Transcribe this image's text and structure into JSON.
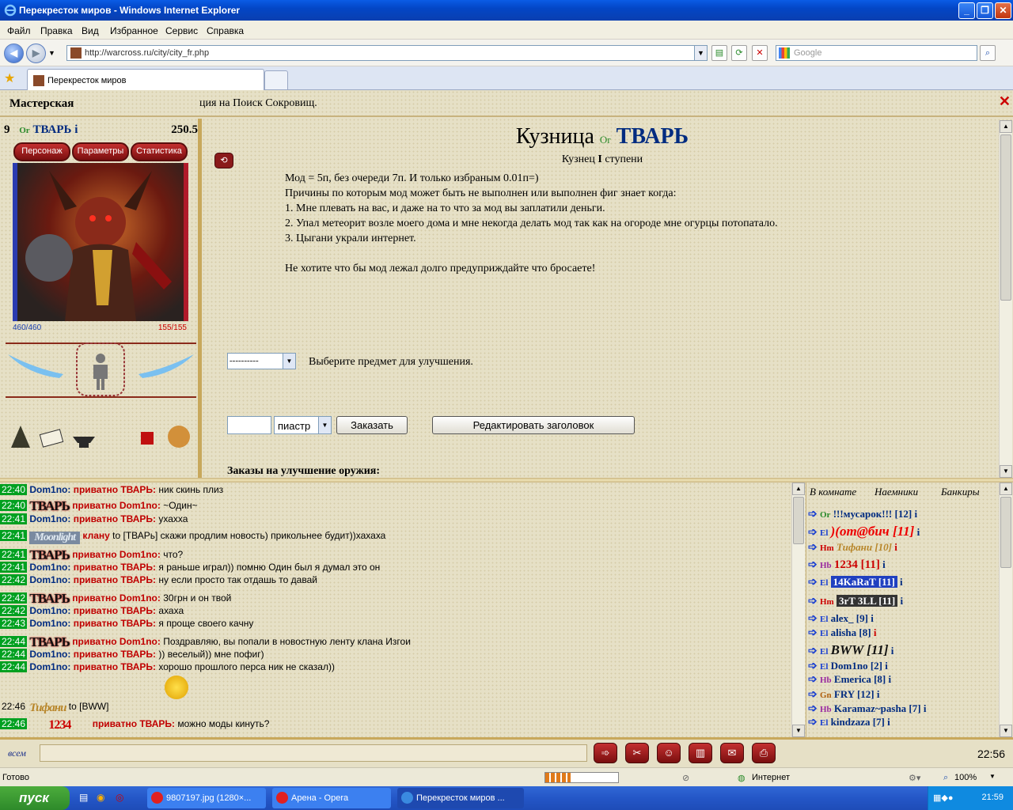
{
  "window": {
    "title": "Перекресток миров - Windows Internet Explorer"
  },
  "menu": [
    "Файл",
    "Правка",
    "Вид",
    "Избранное",
    "Сервис",
    "Справка"
  ],
  "address": {
    "url": "http://warcross.ru/city/city_fr.php"
  },
  "search": {
    "placeholder": "Google"
  },
  "tab": {
    "label": "Перекресток миров"
  },
  "top": {
    "location": "Мастерская",
    "ticker": "ция на Поиск Сокровищ."
  },
  "player": {
    "level": "9",
    "clan": "Or",
    "name": "ТВАРЬ",
    "info": "i",
    "exp": "250.5",
    "hp": "460/460",
    "mana": "155/155",
    "buttons": [
      "Персонаж",
      "Параметры",
      "Статистика"
    ]
  },
  "forge": {
    "title": "Кузница",
    "clan": "Or",
    "owner": "ТВАРЬ",
    "subtitle_pre": "Кузнец",
    "subtitle_level": "I",
    "subtitle_post": "ступени",
    "lines": [
      "Мод = 5п, без очереди 7п. И только избраным 0.01п=)",
      "Причины по которым мод может быть не выполнен или выполнен фиг знает когда:",
      "1. Мне плевать на вас, и даже на то что за мод вы заплатили деньги.",
      "2. Упал метеорит возле моего дома и мне некогда делать мод так как на огороде мне огурцы потопатало.",
      "3. Цыгани украли интернет.",
      "",
      "Не хотите что бы мод лежал долго предуприждайте что бросаете!"
    ],
    "select_value": "----------",
    "select_label": "Выберите предмет для улучшения.",
    "currency": "пиастр",
    "order_button": "Заказать",
    "edit_button": "Редактировать заголовок",
    "orders_title": "Заказы на улучшение оружия:"
  },
  "chat": [
    {
      "time": "22:40",
      "from": "Dom1no:",
      "priv": "приватно ТВАРЬ:",
      "text": "ник скинь плиз"
    },
    {
      "time": "22:40",
      "badge": "ТВАРЬ",
      "priv": "приватно Dom1no:",
      "text": "~Один~"
    },
    {
      "time": "22:41",
      "from": "Dom1no:",
      "priv": "приватно ТВАРЬ:",
      "text": "ухахха"
    },
    {
      "time": "22:41",
      "badge": "Moonlight",
      "priv": "клану",
      "text": "to [ТВАРь] скажи продлим новость) прикольнее будит))хахаха"
    },
    {
      "time": "22:41",
      "badge": "ТВАРЬ",
      "priv": "приватно Dom1no:",
      "text": "что?"
    },
    {
      "time": "22:41",
      "from": "Dom1no:",
      "priv": "приватно ТВАРЬ:",
      "text": "я раньше играл)) помню Один был я думал это он"
    },
    {
      "time": "22:42",
      "from": "Dom1no:",
      "priv": "приватно ТВАРЬ:",
      "text": "ну если просто так отдашь то давай"
    },
    {
      "time": "22:42",
      "badge": "ТВАРЬ",
      "priv": "приватно Dom1no:",
      "text": "30грн и он твой"
    },
    {
      "time": "22:42",
      "from": "Dom1no:",
      "priv": "приватно ТВАРЬ:",
      "text": "ахаха"
    },
    {
      "time": "22:43",
      "from": "Dom1no:",
      "priv": "приватно ТВАРЬ:",
      "text": "я проще своего качну"
    },
    {
      "time": "22:44",
      "badge": "ТВАРЬ",
      "priv": "приватно Dom1no:",
      "text": "Поздравляю, вы попали в новостную ленту клана Изгои"
    },
    {
      "time": "22:44",
      "from": "Dom1no:",
      "priv": "приватно ТВАРЬ:",
      "text": ")) веселый)) мне пофиг)"
    },
    {
      "time": "22:44",
      "from": "Dom1no:",
      "priv": "приватно ТВАРЬ:",
      "text": "хорошо прошлого перса ник не сказал))"
    },
    {
      "time": "22:46",
      "badge": "Тифани",
      "priv": "",
      "text": "to [BWW]"
    },
    {
      "time": "22:46",
      "badge": "1234",
      "priv": "приватно ТВАРЬ:",
      "text": "можно моды кинуть?"
    }
  ],
  "room": {
    "tabs": [
      "В комнате",
      "Наемники",
      "Банкиры"
    ],
    "users": [
      {
        "clan": "Or",
        "name": "!!!мусарок!!! [12]"
      },
      {
        "clan": "El",
        "name": ")(от@бич [11]"
      },
      {
        "clan": "Hm",
        "name": "Тифани [10]"
      },
      {
        "clan": "Hb",
        "name": "1234 [11]"
      },
      {
        "clan": "El",
        "name": "14KaRaT [11]"
      },
      {
        "clan": "Hm",
        "name": "3rT 3LL [11]"
      },
      {
        "clan": "El",
        "name": "alex_ [9]"
      },
      {
        "clan": "El",
        "name": "alisha [8]"
      },
      {
        "clan": "El",
        "name": "BWW [11]"
      },
      {
        "clan": "El",
        "name": "Dom1no [2]"
      },
      {
        "clan": "Hb",
        "name": "Emerica [8]"
      },
      {
        "clan": "Gn",
        "name": "FRY [12]"
      },
      {
        "clan": "Hb",
        "name": "Karamaz~pasha [7]"
      },
      {
        "clan": "El",
        "name": "kindzaza [7]"
      }
    ]
  },
  "chatbar": {
    "all_label": "всем",
    "time": "22:56"
  },
  "status": {
    "ready": "Готово",
    "zone": "Интернет",
    "zoom": "100%"
  },
  "taskbar": {
    "start": "пуск",
    "tasks": [
      "9807197.jpg (1280×...",
      "Арена - Opera",
      "Перекресток миров ..."
    ],
    "clock": "21:59"
  }
}
